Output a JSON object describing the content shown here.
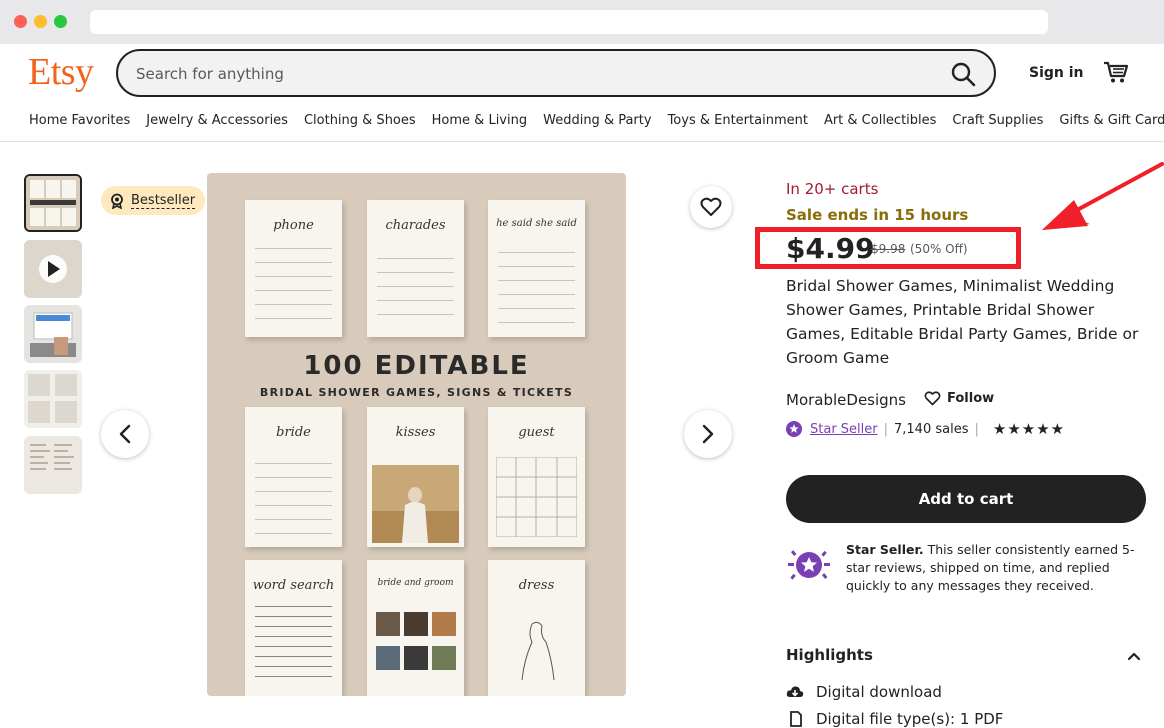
{
  "browser": {
    "url": ""
  },
  "header": {
    "logo": "Etsy",
    "search_placeholder": "Search for anything",
    "sign_in": "Sign in"
  },
  "categories": [
    "Home Favorites",
    "Jewelry & Accessories",
    "Clothing & Shoes",
    "Home & Living",
    "Wedding & Party",
    "Toys & Entertainment",
    "Art & Collectibles",
    "Craft Supplies",
    "Gifts & Gift Cards"
  ],
  "gallery": {
    "badge": "Bestseller",
    "image_headline": "100 EDITABLE",
    "image_subheadline": "BRIDAL SHOWER GAMES, SIGNS & TICKETS",
    "card_titles": [
      "phone",
      "charades",
      "he said she said",
      "bride",
      "kisses",
      "guest",
      "word search",
      "bride and groom",
      "dress"
    ]
  },
  "listing": {
    "in_carts": "In 20+ carts",
    "sale_ends": "Sale ends in 15 hours",
    "price": "$4.99",
    "original_price": "$9.98",
    "discount": "(50% Off)",
    "title": "Bridal Shower Games, Minimalist Wedding Shower Games, Printable Bridal Shower Games, Editable Bridal Party Games, Bride or Groom Game",
    "shop_name": "MorableDesigns",
    "follow": "Follow",
    "star_seller": "Star Seller",
    "sales": "7,140 sales",
    "rating_stars": "★★★★★",
    "add_to_cart": "Add to cart",
    "star_seller_heading": "Star Seller.",
    "star_seller_desc": " This seller consistently earned 5-star reviews, shipped on time, and replied quickly to any messages they received."
  },
  "highlights": {
    "title": "Highlights",
    "items": [
      "Digital download",
      "Digital file type(s): 1 PDF"
    ]
  },
  "colors": {
    "brand": "#f1641e",
    "annotation": "#f0202a",
    "star_seller": "#7b3fb4"
  }
}
